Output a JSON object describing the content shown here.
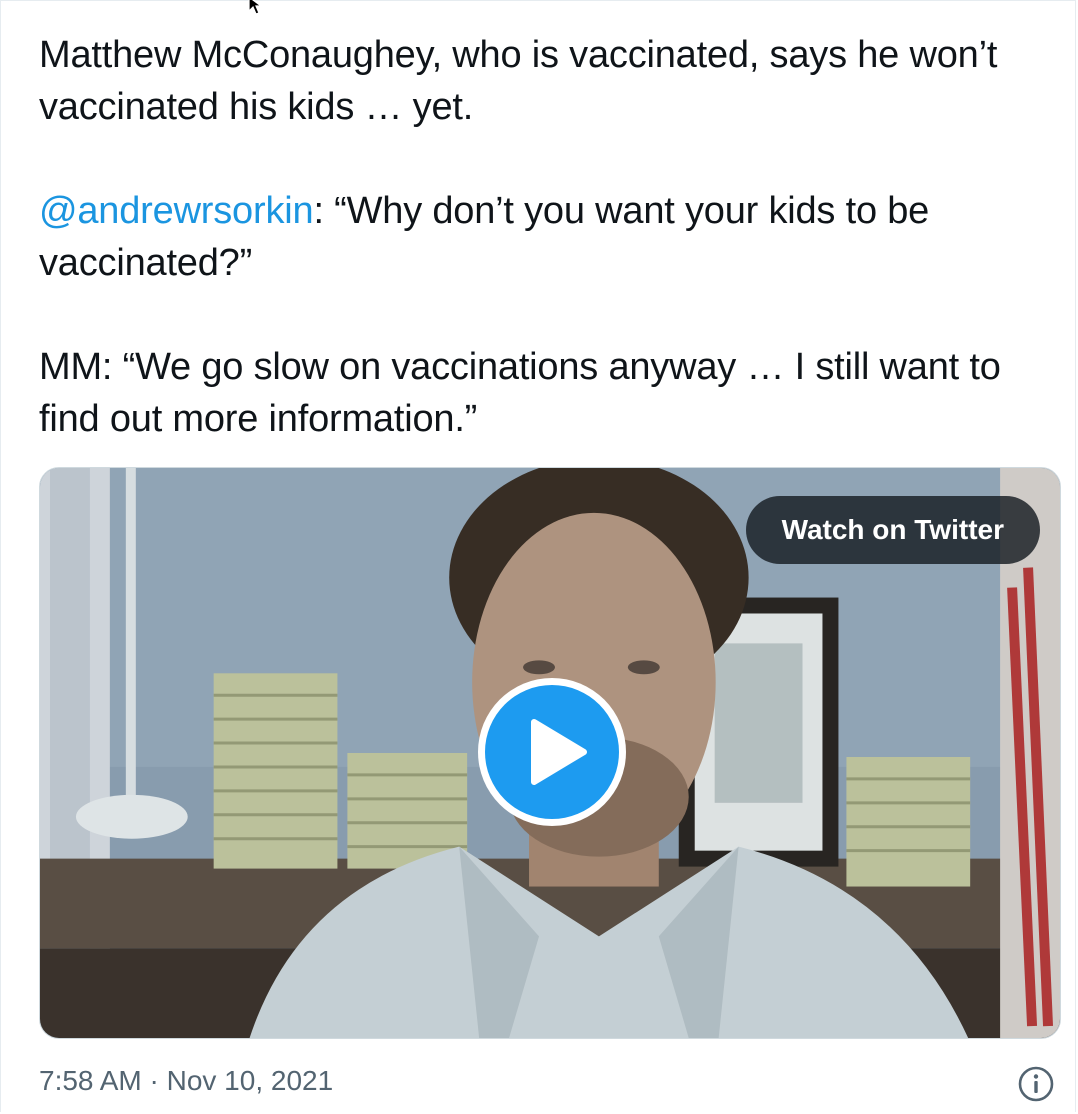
{
  "tweet": {
    "paragraph1": "Matthew McConaughey, who is vaccinated, says he won’t vaccinated his kids … yet.",
    "mention": "@andrewrsorkin",
    "paragraph2_rest": ": “Why don’t you want your kids to be vaccinated?”",
    "paragraph3": "MM: “We go slow on vaccinations anyway … I still want to find out more information.”",
    "timestamp": "7:58 AM · Nov 10, 2021"
  },
  "media": {
    "watch_label": "Watch on Twitter",
    "play_icon": "play-icon"
  },
  "icons": {
    "info": "info-icon",
    "cursor": "mouse-cursor-icon"
  },
  "colors": {
    "text": "#0f1419",
    "link": "#1b95e0",
    "secondary": "#536471",
    "play_blue": "#1d9bf0",
    "pill_bg": "#161c22"
  }
}
